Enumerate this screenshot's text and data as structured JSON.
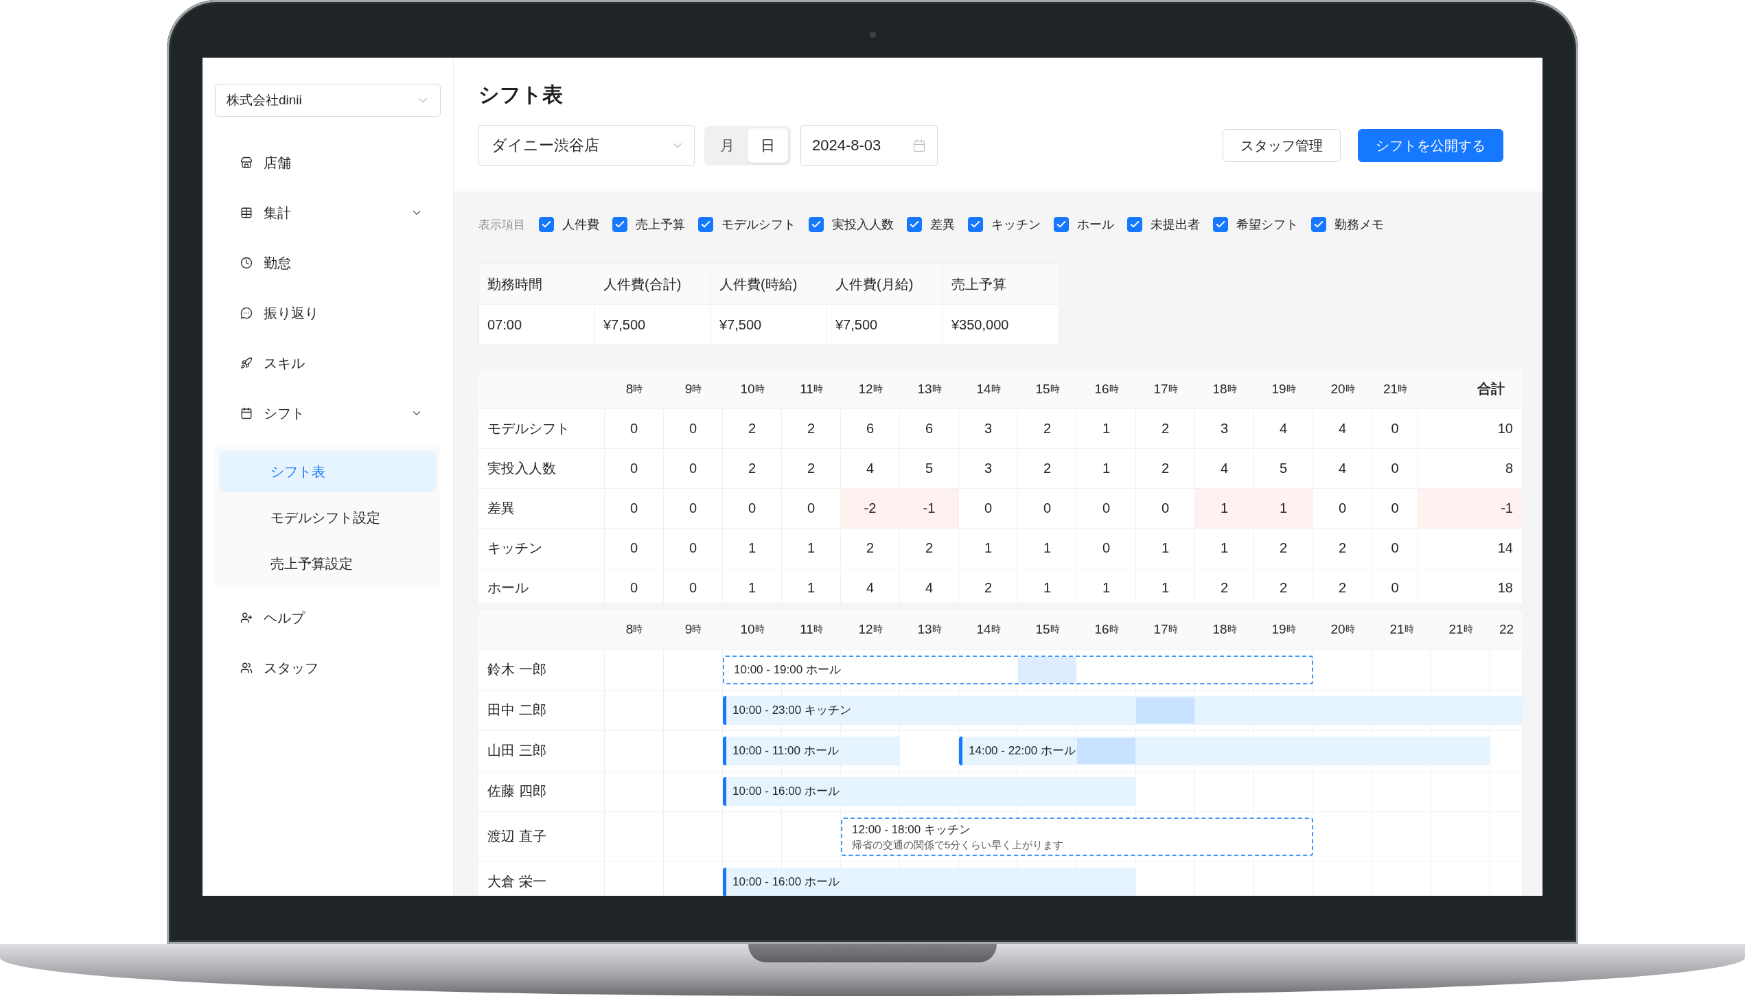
{
  "sidebar": {
    "company_select": {
      "value": "株式会社dinii"
    },
    "items": [
      {
        "label": "店舗",
        "kind": "link",
        "selected": false
      },
      {
        "label": "集計",
        "kind": "group",
        "selected": false
      },
      {
        "label": "勤怠",
        "kind": "link",
        "selected": false
      },
      {
        "label": "振り返り",
        "kind": "link",
        "selected": false
      },
      {
        "label": "スキル",
        "kind": "link",
        "selected": false
      },
      {
        "label": "シフト",
        "kind": "group",
        "selected": false,
        "children": [
          {
            "label": "シフト表",
            "selected": true
          },
          {
            "label": "モデルシフト設定",
            "selected": false
          },
          {
            "label": "売上予算設定",
            "selected": false
          }
        ]
      },
      {
        "label": "ヘルプ",
        "kind": "link",
        "selected": false
      },
      {
        "label": "スタッフ",
        "kind": "link",
        "selected": false
      }
    ]
  },
  "header": {
    "title": "シフト表",
    "store_select": {
      "value": "ダイニー渋谷店"
    },
    "view_tabs": [
      {
        "label": "月",
        "selected": false
      },
      {
        "label": "日",
        "selected": true
      }
    ],
    "date_field": {
      "value": "2024-8-03"
    },
    "buttons": [
      {
        "label": "スタッフ管理",
        "kind": "default"
      },
      {
        "label": "シフトを公開する",
        "kind": "primary"
      }
    ]
  },
  "display_options": {
    "label": "表示項目",
    "items": [
      {
        "label": "人件費",
        "checked": true
      },
      {
        "label": "売上予算",
        "checked": true
      },
      {
        "label": "モデルシフト",
        "checked": true
      },
      {
        "label": "実投入人数",
        "checked": true
      },
      {
        "label": "差異",
        "checked": true
      },
      {
        "label": "キッチン",
        "checked": true
      },
      {
        "label": "ホール",
        "checked": true
      },
      {
        "label": "未提出者",
        "checked": true
      },
      {
        "label": "希望シフト",
        "checked": true
      },
      {
        "label": "勤務メモ",
        "checked": true
      }
    ]
  },
  "cost_summary": {
    "columns": [
      "勤務時間",
      "人件費(合計)",
      "人件費(時給)",
      "人件費(月給)",
      "売上予算"
    ],
    "rows": [
      [
        "07:00",
        "¥7,500",
        "¥7,500",
        "¥7,500",
        "¥350,000"
      ]
    ]
  },
  "hourly_table": {
    "hours": [
      {
        "num": "8",
        "unit": "時"
      },
      {
        "num": "9",
        "unit": "時"
      },
      {
        "num": "10",
        "unit": "時"
      },
      {
        "num": "11",
        "unit": "時"
      },
      {
        "num": "12",
        "unit": "時"
      },
      {
        "num": "13",
        "unit": "時"
      },
      {
        "num": "14",
        "unit": "時"
      },
      {
        "num": "15",
        "unit": "時"
      },
      {
        "num": "16",
        "unit": "時"
      },
      {
        "num": "17",
        "unit": "時"
      },
      {
        "num": "18",
        "unit": "時"
      },
      {
        "num": "19",
        "unit": "時"
      },
      {
        "num": "20",
        "unit": "時"
      },
      {
        "num": "21",
        "unit": "時"
      }
    ],
    "total_label": "合計",
    "rows": [
      {
        "label": "モデルシフト",
        "cells": [
          {
            "text": "0",
            "flagged": false
          },
          {
            "text": "0",
            "flagged": false
          },
          {
            "text": "2",
            "flagged": false
          },
          {
            "text": "2",
            "flagged": false
          },
          {
            "text": "6",
            "flagged": false
          },
          {
            "text": "6",
            "flagged": false
          },
          {
            "text": "3",
            "flagged": false
          },
          {
            "text": "2",
            "flagged": false
          },
          {
            "text": "1",
            "flagged": false
          },
          {
            "text": "2",
            "flagged": false
          },
          {
            "text": "3",
            "flagged": false
          },
          {
            "text": "4",
            "flagged": false
          },
          {
            "text": "4",
            "flagged": false
          },
          {
            "text": "0",
            "flagged": false
          }
        ],
        "total": {
          "text": "10",
          "flagged": false
        }
      },
      {
        "label": "実投入人数",
        "cells": [
          {
            "text": "0",
            "flagged": false
          },
          {
            "text": "0",
            "flagged": false
          },
          {
            "text": "2",
            "flagged": false
          },
          {
            "text": "2",
            "flagged": false
          },
          {
            "text": "4",
            "flagged": false
          },
          {
            "text": "5",
            "flagged": false
          },
          {
            "text": "3",
            "flagged": false
          },
          {
            "text": "2",
            "flagged": false
          },
          {
            "text": "1",
            "flagged": false
          },
          {
            "text": "2",
            "flagged": false
          },
          {
            "text": "4",
            "flagged": false
          },
          {
            "text": "5",
            "flagged": false
          },
          {
            "text": "4",
            "flagged": false
          },
          {
            "text": "0",
            "flagged": false
          }
        ],
        "total": {
          "text": "8",
          "flagged": false
        }
      },
      {
        "label": "差異",
        "cells": [
          {
            "text": "0",
            "flagged": false
          },
          {
            "text": "0",
            "flagged": false
          },
          {
            "text": "0",
            "flagged": false
          },
          {
            "text": "0",
            "flagged": false
          },
          {
            "text": "-2",
            "flagged": true
          },
          {
            "text": "-1",
            "flagged": true
          },
          {
            "text": "0",
            "flagged": false
          },
          {
            "text": "0",
            "flagged": false
          },
          {
            "text": "0",
            "flagged": false
          },
          {
            "text": "0",
            "flagged": false
          },
          {
            "text": "1",
            "flagged": true
          },
          {
            "text": "1",
            "flagged": true
          },
          {
            "text": "0",
            "flagged": false
          },
          {
            "text": "0",
            "flagged": false
          }
        ],
        "total": {
          "text": "-1",
          "flagged": true
        }
      },
      {
        "label": "キッチン",
        "cells": [
          {
            "text": "0",
            "flagged": false
          },
          {
            "text": "0",
            "flagged": false
          },
          {
            "text": "1",
            "flagged": false
          },
          {
            "text": "1",
            "flagged": false
          },
          {
            "text": "2",
            "flagged": false
          },
          {
            "text": "2",
            "flagged": false
          },
          {
            "text": "1",
            "flagged": false
          },
          {
            "text": "1",
            "flagged": false
          },
          {
            "text": "0",
            "flagged": false
          },
          {
            "text": "1",
            "flagged": false
          },
          {
            "text": "1",
            "flagged": false
          },
          {
            "text": "2",
            "flagged": false
          },
          {
            "text": "2",
            "flagged": false
          },
          {
            "text": "0",
            "flagged": false
          }
        ],
        "total": {
          "text": "14",
          "flagged": false
        }
      },
      {
        "label": "ホール",
        "cells": [
          {
            "text": "0",
            "flagged": false
          },
          {
            "text": "0",
            "flagged": false
          },
          {
            "text": "1",
            "flagged": false
          },
          {
            "text": "1",
            "flagged": false
          },
          {
            "text": "4",
            "flagged": false
          },
          {
            "text": "4",
            "flagged": false
          },
          {
            "text": "2",
            "flagged": false
          },
          {
            "text": "1",
            "flagged": false
          },
          {
            "text": "1",
            "flagged": false
          },
          {
            "text": "1",
            "flagged": false
          },
          {
            "text": "2",
            "flagged": false
          },
          {
            "text": "2",
            "flagged": false
          },
          {
            "text": "2",
            "flagged": false
          },
          {
            "text": "0",
            "flagged": false
          }
        ],
        "total": {
          "text": "18",
          "flagged": false
        }
      }
    ]
  },
  "timeline": {
    "hours": [
      {
        "num": "8",
        "unit": "時"
      },
      {
        "num": "9",
        "unit": "時"
      },
      {
        "num": "10",
        "unit": "時"
      },
      {
        "num": "11",
        "unit": "時"
      },
      {
        "num": "12",
        "unit": "時"
      },
      {
        "num": "13",
        "unit": "時"
      },
      {
        "num": "14",
        "unit": "時"
      },
      {
        "num": "15",
        "unit": "時"
      },
      {
        "num": "16",
        "unit": "時"
      },
      {
        "num": "17",
        "unit": "時"
      },
      {
        "num": "18",
        "unit": "時"
      },
      {
        "num": "19",
        "unit": "時"
      },
      {
        "num": "20",
        "unit": "時"
      },
      {
        "num": "21",
        "unit": "時"
      },
      {
        "num": "21",
        "unit": "時"
      },
      {
        "num": "22"
      }
    ],
    "rows": [
      {
        "name": "鈴木 一郎",
        "slots": [
          {
            "kind": "empty",
            "highlighted": false
          },
          {
            "kind": "empty",
            "highlighted": false
          },
          {
            "kind": "requested",
            "label": "10:00 - 19:00 ホール",
            "highlighted": false
          },
          {
            "kind": "requested",
            "highlighted": false
          },
          {
            "kind": "requested",
            "highlighted": false
          },
          {
            "kind": "requested",
            "highlighted": false
          },
          {
            "kind": "requested",
            "highlighted": false
          },
          {
            "kind": "requested",
            "highlighted": true
          },
          {
            "kind": "requested",
            "highlighted": false
          },
          {
            "kind": "requested",
            "highlighted": false
          },
          {
            "kind": "requested",
            "highlighted": false
          },
          {
            "kind": "requested",
            "highlighted": false
          },
          {
            "kind": "empty",
            "highlighted": false
          },
          {
            "kind": "empty",
            "highlighted": false
          },
          {
            "kind": "empty",
            "highlighted": false
          },
          {
            "kind": "empty",
            "highlighted": false
          }
        ]
      },
      {
        "name": "田中 二郎",
        "slots": [
          {
            "kind": "empty",
            "highlighted": false
          },
          {
            "kind": "empty",
            "highlighted": false
          },
          {
            "kind": "assigned",
            "label": "10:00 - 23:00 キッチン",
            "highlighted": false
          },
          {
            "kind": "assigned",
            "highlighted": false
          },
          {
            "kind": "assigned",
            "highlighted": false
          },
          {
            "kind": "assigned",
            "highlighted": false
          },
          {
            "kind": "assigned",
            "highlighted": false
          },
          {
            "kind": "assigned",
            "highlighted": false
          },
          {
            "kind": "assigned",
            "highlighted": false
          },
          {
            "kind": "assigned",
            "highlighted": true
          },
          {
            "kind": "assigned",
            "highlighted": false
          },
          {
            "kind": "assigned",
            "highlighted": false
          },
          {
            "kind": "assigned",
            "highlighted": false
          },
          {
            "kind": "assigned",
            "highlighted": false
          },
          {
            "kind": "assigned",
            "highlighted": false
          },
          {
            "kind": "assigned",
            "highlighted": false
          }
        ]
      },
      {
        "name": "山田 三郎",
        "slots": [
          {
            "kind": "empty",
            "highlighted": false
          },
          {
            "kind": "empty",
            "highlighted": false
          },
          {
            "kind": "assigned",
            "label": "10:00 - 11:00 ホール",
            "highlighted": false
          },
          {
            "kind": "assigned",
            "highlighted": false
          },
          {
            "kind": "assigned",
            "highlighted": false
          },
          {
            "kind": "empty",
            "highlighted": false
          },
          {
            "kind": "assigned",
            "label": "14:00 - 22:00 ホール",
            "highlighted": false
          },
          {
            "kind": "assigned",
            "highlighted": false
          },
          {
            "kind": "assigned",
            "highlighted": true
          },
          {
            "kind": "assigned",
            "highlighted": false
          },
          {
            "kind": "assigned",
            "highlighted": false
          },
          {
            "kind": "assigned",
            "highlighted": false
          },
          {
            "kind": "assigned",
            "highlighted": false
          },
          {
            "kind": "assigned",
            "highlighted": false
          },
          {
            "kind": "assigned",
            "highlighted": false
          },
          {
            "kind": "empty",
            "highlighted": false
          }
        ]
      },
      {
        "name": "佐藤 四郎",
        "slots": [
          {
            "kind": "empty",
            "highlighted": false
          },
          {
            "kind": "empty",
            "highlighted": false
          },
          {
            "kind": "assigned",
            "label": "10:00 - 16:00 ホール",
            "highlighted": false
          },
          {
            "kind": "assigned",
            "highlighted": false
          },
          {
            "kind": "assigned",
            "highlighted": false
          },
          {
            "kind": "assigned",
            "highlighted": false
          },
          {
            "kind": "assigned",
            "highlighted": false
          },
          {
            "kind": "assigned",
            "highlighted": false
          },
          {
            "kind": "assigned",
            "highlighted": false
          },
          {
            "kind": "empty",
            "highlighted": false
          },
          {
            "kind": "empty",
            "highlighted": false
          },
          {
            "kind": "empty",
            "highlighted": false
          },
          {
            "kind": "empty",
            "highlighted": false
          },
          {
            "kind": "empty",
            "highlighted": false
          },
          {
            "kind": "empty",
            "highlighted": false
          },
          {
            "kind": "empty",
            "highlighted": false
          }
        ]
      },
      {
        "name": "渡辺 直子",
        "slots": [
          {
            "kind": "empty",
            "highlighted": false
          },
          {
            "kind": "empty",
            "highlighted": false
          },
          {
            "kind": "empty",
            "highlighted": false
          },
          {
            "kind": "empty",
            "highlighted": false
          },
          {
            "kind": "requested",
            "label": "12:00 - 18:00 キッチン",
            "note": "帰省の交通の関係で5分くらい早く上がります",
            "highlighted": false
          },
          {
            "kind": "requested",
            "highlighted": false
          },
          {
            "kind": "requested",
            "highlighted": false
          },
          {
            "kind": "requested",
            "highlighted": false
          },
          {
            "kind": "requested",
            "highlighted": false
          },
          {
            "kind": "requested",
            "highlighted": false
          },
          {
            "kind": "requested",
            "highlighted": false
          },
          {
            "kind": "requested",
            "highlighted": false
          },
          {
            "kind": "empty",
            "highlighted": false
          },
          {
            "kind": "empty",
            "highlighted": false
          },
          {
            "kind": "empty",
            "highlighted": false
          },
          {
            "kind": "empty",
            "highlighted": false
          }
        ]
      },
      {
        "name": "大倉 栄一",
        "slots": [
          {
            "kind": "empty",
            "highlighted": false
          },
          {
            "kind": "empty",
            "highlighted": false
          },
          {
            "kind": "assigned",
            "label": "10:00 - 16:00 ホール",
            "highlighted": false
          },
          {
            "kind": "assigned",
            "highlighted": false
          },
          {
            "kind": "assigned",
            "highlighted": false
          },
          {
            "kind": "assigned",
            "highlighted": false
          },
          {
            "kind": "assigned",
            "highlighted": false
          },
          {
            "kind": "assigned",
            "highlighted": false
          },
          {
            "kind": "assigned",
            "highlighted": false
          },
          {
            "kind": "empty",
            "highlighted": false
          },
          {
            "kind": "empty",
            "highlighted": false
          },
          {
            "kind": "empty",
            "highlighted": false
          },
          {
            "kind": "empty",
            "highlighted": false
          },
          {
            "kind": "empty",
            "highlighted": false
          },
          {
            "kind": "empty",
            "highlighted": false
          },
          {
            "kind": "empty",
            "highlighted": false
          }
        ]
      }
    ]
  }
}
